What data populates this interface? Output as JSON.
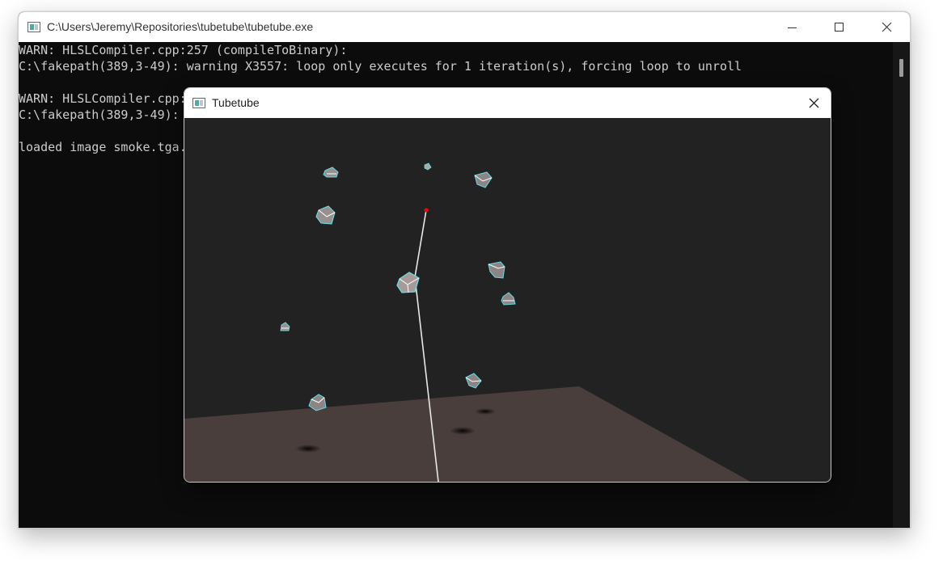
{
  "console": {
    "title": "C:\\Users\\Jeremy\\Repositories\\tubetube\\tubetube.exe",
    "icon": "console-app-icon",
    "controls": {
      "minimize": "minimize-icon",
      "maximize": "maximize-icon",
      "close": "close-icon"
    },
    "lines": [
      "WARN: HLSLCompiler.cpp:257 (compileToBinary):",
      "C:\\fakepath(389,3-49): warning X3557: loop only executes for 1 iteration(s), forcing loop to unroll",
      "",
      "WARN: HLSLCompiler.cpp:",
      "C:\\fakepath(389,3-49):",
      "",
      "loaded image smoke.tga."
    ]
  },
  "app": {
    "title": "Tubetube",
    "icon": "tubetube-app-icon",
    "close_icon": "close-icon",
    "scene": {
      "colors": {
        "background": "#222222",
        "floor": "#4a3e3c",
        "line": "#e8e8e8",
        "target": "#ff0000"
      }
    }
  }
}
